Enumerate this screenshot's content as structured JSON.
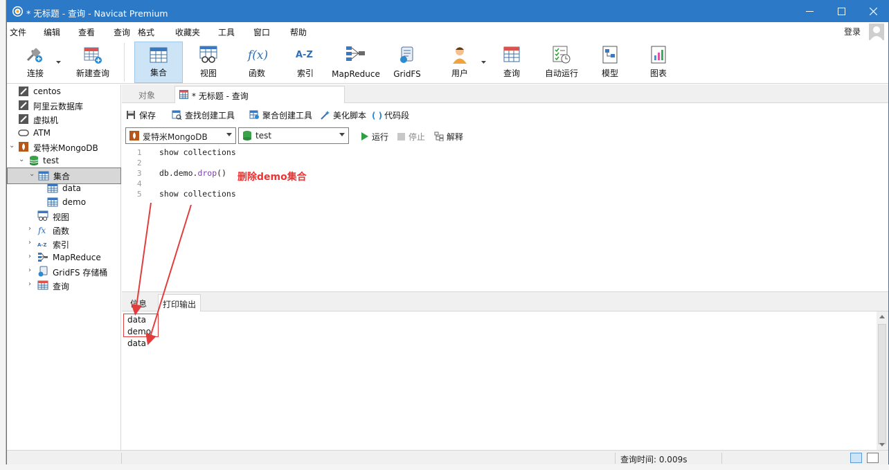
{
  "window": {
    "title": "* 无标题 - 查询 - Navicat Premium",
    "minimize": "—",
    "maximize": "☐",
    "close": "✕"
  },
  "menu": {
    "items": [
      "文件",
      "编辑",
      "查看",
      "查询",
      "格式",
      "收藏夹",
      "工具",
      "窗口",
      "帮助"
    ],
    "login": "登录"
  },
  "toolbar": {
    "connect": "连接",
    "new_query": "新建查询",
    "collection": "集合",
    "view": "视图",
    "function": "函数",
    "index": "索引",
    "mapreduce": "MapReduce",
    "gridfs": "GridFS",
    "user": "用户",
    "query": "查询",
    "automation": "自动运行",
    "model": "模型",
    "chart": "图表",
    "index_glyph": "A-Z",
    "function_glyph": "f(x)"
  },
  "tree": {
    "connections": [
      "centos",
      "阿里云数据库",
      "虚拟机",
      "ATM"
    ],
    "active_connection": "爱特米MongoDB",
    "database": "test",
    "collections_folder": "集合",
    "collections": [
      "data",
      "demo"
    ],
    "folders": {
      "view": "视图",
      "function": "函数",
      "index": "索引",
      "mapreduce": "MapReduce",
      "gridfs": "GridFS 存储桶",
      "query": "查询"
    },
    "function_glyph": "fx",
    "index_glyph": "A-Z"
  },
  "tabs": {
    "objects": "对象",
    "query": "* 无标题 - 查询"
  },
  "query_toolbar": {
    "save": "保存",
    "find_builder": "查找创建工具",
    "aggregate_builder": "聚合创建工具",
    "beautify": "美化脚本",
    "snippet": "代码段",
    "snippet_glyph": "( )"
  },
  "selectors": {
    "connection": "爱特米MongoDB",
    "database": "test",
    "run": "运行",
    "stop": "停止",
    "explain": "解释"
  },
  "editor": {
    "line_numbers": [
      "1",
      "2",
      "3",
      "4",
      "5"
    ],
    "lines": [
      "show collections",
      "",
      "db.demo.drop()",
      "",
      "show collections"
    ],
    "line3_parts": {
      "obj": "db",
      "dot1": ".",
      "coll": "demo",
      "dot2": ".",
      "fn": "drop",
      "paren": "()"
    },
    "annotation": "删除demo集合"
  },
  "results": {
    "tab_info": "信息",
    "tab_print": "打印输出",
    "output": [
      "data",
      "demo",
      "data"
    ]
  },
  "status": {
    "query_time": "查询时间: 0.009s"
  },
  "colors": {
    "titlebar": "#2b79c7",
    "accent_selected": "#cde4f7",
    "annotation_red": "#ee3333"
  }
}
